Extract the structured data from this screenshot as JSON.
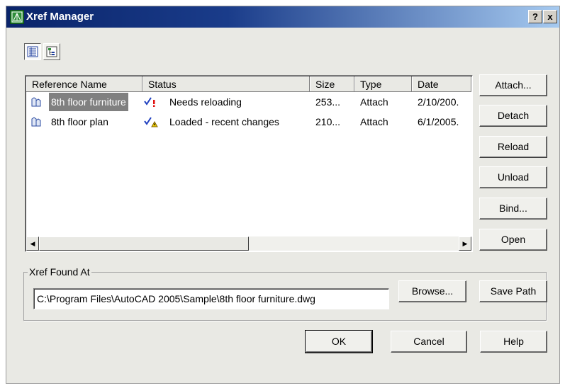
{
  "window": {
    "title": "Xref Manager",
    "help_btn": "?",
    "close_btn": "x"
  },
  "toolbar": {
    "list_view_icon": "list-view-icon",
    "tree_view_icon": "tree-view-icon"
  },
  "table": {
    "columns": [
      "Reference Name",
      "Status",
      "Size",
      "Type",
      "Date"
    ],
    "rows": [
      {
        "name": "8th floor furniture",
        "status": "Needs reloading",
        "size": "253...",
        "type": "Attach",
        "date": "2/10/200.",
        "selected": true
      },
      {
        "name": "8th floor plan",
        "status": "Loaded - recent changes",
        "size": "210...",
        "type": "Attach",
        "date": "6/1/2005.",
        "selected": false
      }
    ]
  },
  "side_buttons": {
    "attach": "Attach...",
    "detach": "Detach",
    "reload": "Reload",
    "unload": "Unload",
    "bind": "Bind...",
    "open": "Open"
  },
  "found_at": {
    "label": "Xref Found At",
    "path": "C:\\Program Files\\AutoCAD 2005\\Sample\\8th floor furniture.dwg",
    "browse": "Browse...",
    "save_path": "Save Path"
  },
  "footer": {
    "ok": "OK",
    "cancel": "Cancel",
    "help": "Help"
  }
}
